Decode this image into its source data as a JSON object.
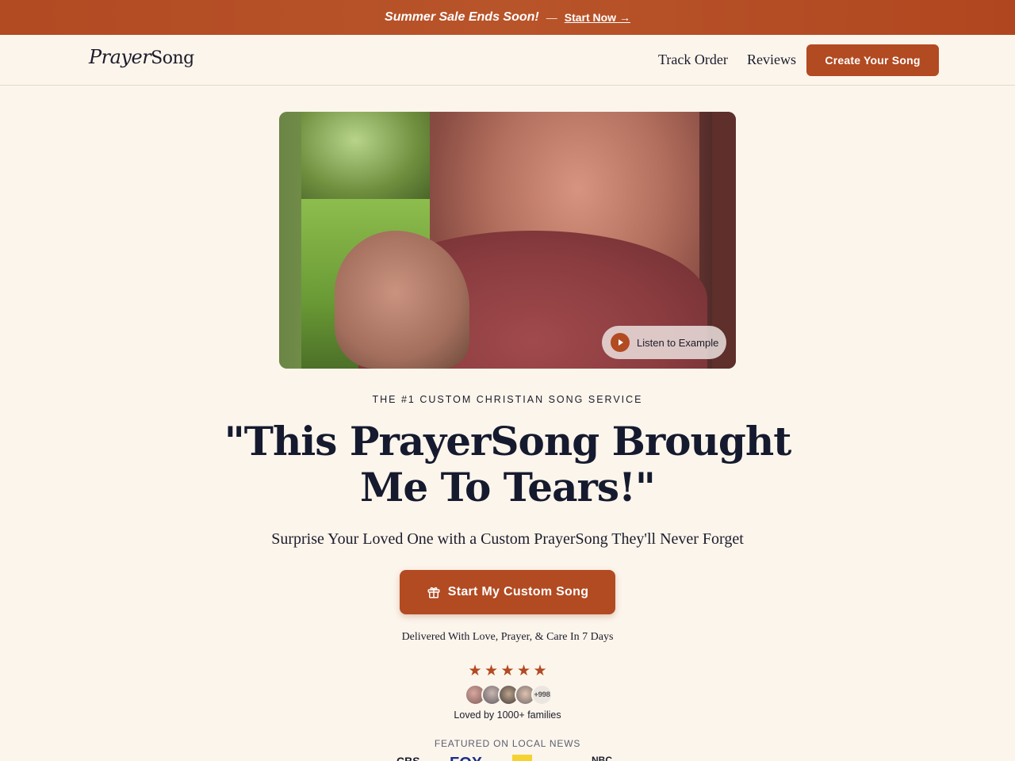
{
  "promo": {
    "text": "Summer Sale Ends Soon!",
    "separator": "—",
    "link": "Start Now →"
  },
  "nav": {
    "logo_part1": "Prayer",
    "logo_part2": "Song",
    "links": [
      "Track Order",
      "Reviews"
    ],
    "cta": "Create Your Song"
  },
  "hero": {
    "listen_label": "Listen to Example",
    "kicker": "THE #1 CUSTOM CHRISTIAN SONG SERVICE",
    "headline": "\"This PrayerSong Brought Me To Tears!\"",
    "subhead": "Surprise Your Loved One with a Custom PrayerSong They'll Never Forget",
    "cta": "Start My Custom Song",
    "delivery": "Delivered With Love, Prayer, & Care In 7 Days"
  },
  "social_proof": {
    "rating": 5,
    "stars": [
      "★",
      "★",
      "★",
      "★",
      "★"
    ],
    "more_count": "+998",
    "loved_text": "Loved by 1000+ families",
    "featured_label": "FEATURED ON LOCAL NEWS"
  },
  "news_logos": [
    "CBS",
    "FOX",
    "",
    "",
    "NBC"
  ],
  "colors": {
    "accent": "#b24a22",
    "background": "#fcf5ec",
    "headline": "#151a2e"
  }
}
